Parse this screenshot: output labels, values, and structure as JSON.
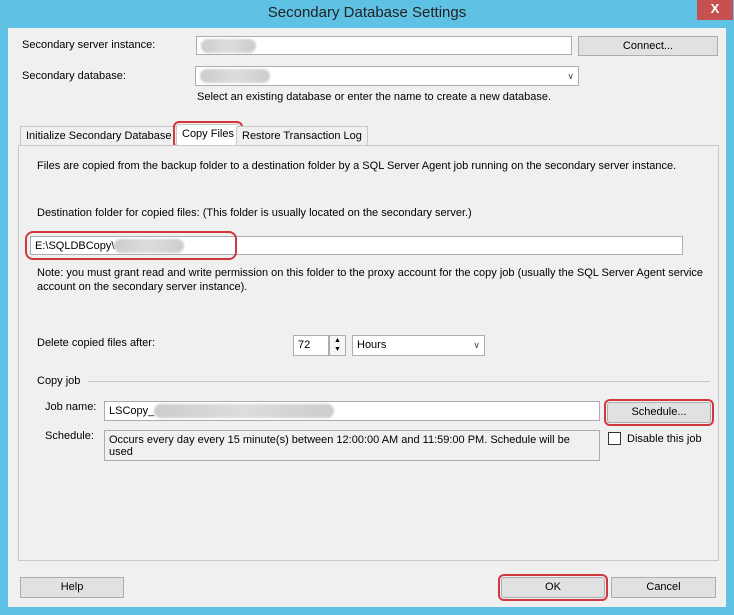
{
  "window": {
    "title": "Secondary Database Settings",
    "close_label": "X"
  },
  "server": {
    "label": "Secondary server instance:",
    "value": "",
    "connect_label": "Connect..."
  },
  "database": {
    "label": "Secondary database:",
    "value": "",
    "hint": "Select an existing database or enter the name to create a new database."
  },
  "tabs": [
    {
      "label": "Initialize Secondary Database"
    },
    {
      "label": "Copy Files",
      "selected": true
    },
    {
      "label": "Restore Transaction Log"
    }
  ],
  "copy_files": {
    "description": "Files are copied from the backup folder to a destination folder by a SQL Server Agent job running on the secondary server instance.",
    "dest_label": "Destination folder for copied files: (This folder is usually located on the secondary server.)",
    "dest_value": "E:\\SQLDBCopy\\",
    "note": "Note: you must grant read and write permission on this folder to the proxy account for the copy job (usually the SQL Server Agent service account on the secondary server instance).",
    "delete_label": "Delete copied files after:",
    "delete_value": "72",
    "delete_unit": "Hours",
    "copy_job_group": "Copy job",
    "job_name_label": "Job name:",
    "job_name_value": "LSCopy_",
    "schedule_button": "Schedule...",
    "schedule_label": "Schedule:",
    "schedule_value": "Occurs every day every 15 minute(s) between 12:00:00 AM and 11:59:00 PM. Schedule will be used",
    "disable_label": "Disable this job",
    "disable_checked": false
  },
  "footer": {
    "help": "Help",
    "ok": "OK",
    "cancel": "Cancel"
  },
  "colors": {
    "highlight": "#d0383d",
    "frame": "#5fc2e4",
    "close": "#c75050"
  }
}
